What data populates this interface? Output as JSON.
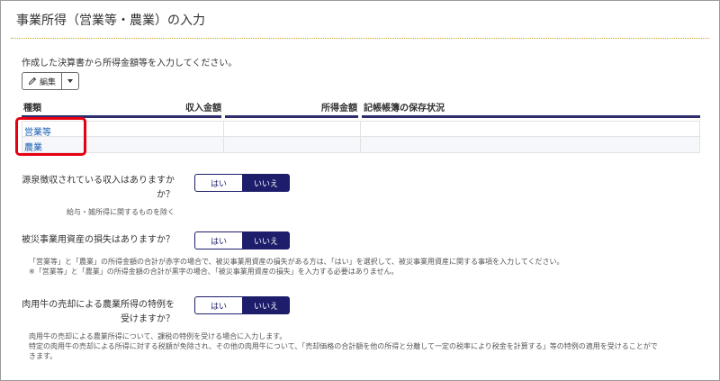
{
  "page": {
    "title": "事業所得（営業等・農業）の入力",
    "intro": "作成した決算書から所得金額等を入力してください。"
  },
  "toolbar": {
    "edit_label": "編集",
    "edit_icon": "pencil-icon",
    "dropdown_icon": "caret-down-icon"
  },
  "table": {
    "columns": [
      "種類",
      "収入金額",
      "所得金額",
      "記帳帳簿の保存状況"
    ],
    "rows": [
      {
        "label": "営業等",
        "income": "",
        "profit": "",
        "status": ""
      },
      {
        "label": "農業",
        "income": "",
        "profit": "",
        "status": ""
      }
    ]
  },
  "questions": [
    {
      "label_line1": "源泉徴収されている収入はありますか",
      "label_line2": "か？",
      "yes": "はい",
      "no": "いいえ",
      "selected": "いいえ",
      "note": "給与・雑所得に関するものを除く"
    },
    {
      "label": "被災事業用資産の損失はありますか？",
      "yes": "はい",
      "no": "いいえ",
      "selected": "いいえ",
      "notes": [
        "「営業等」と「農業」の所得金額の合計が赤字の場合で、被災事業用資産の損失がある方は、「はい」を選択して、被災事業用資産に関する事項を入力してください。",
        "※「営業等」と「農業」の所得金額の合計が黒字の場合、「被災事業用資産の損失」を入力する必要はありません。"
      ]
    },
    {
      "label_line1": "肉用牛の売却による農業所得の特例を",
      "label_line2": "受けますか？",
      "yes": "はい",
      "no": "いいえ",
      "selected": "いいえ",
      "notes": [
        "肉用牛の売却による農業所得について、課税の特例を受ける場合に入力します。",
        "特定の肉用牛の売却による所得に対する税額が免除され、その他の肉用牛について、「売却価格の合計額を他の所得と分離して一定の税率により税金を計算する」等の特例の適用を受けることがで",
        "きます。"
      ]
    }
  ],
  "colors": {
    "accent_navy": "#1d1d6b",
    "header_rule": "#2e2e6e",
    "link_blue": "#1a5fb4",
    "highlight_red": "#e60012",
    "title_rule_gold": "#c9a227"
  }
}
